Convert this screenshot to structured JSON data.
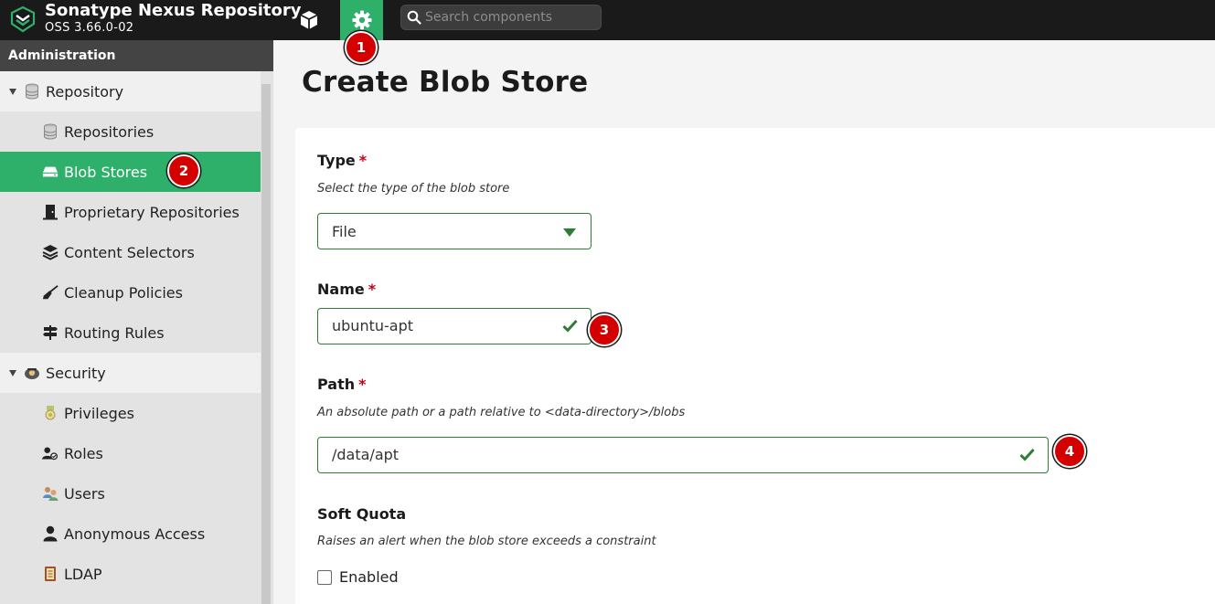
{
  "header": {
    "app_name": "Sonatype Nexus Repository",
    "version": "OSS 3.66.0-02",
    "search_placeholder": "Search components"
  },
  "badges": [
    "1",
    "2",
    "3",
    "4"
  ],
  "sidebar": {
    "header": "Administration",
    "items": [
      {
        "label": "Repository",
        "icon": "database-icon",
        "kind": "group"
      },
      {
        "label": "Repositories",
        "icon": "database-icon",
        "kind": "sub"
      },
      {
        "label": "Blob Stores",
        "icon": "hard-drive-icon",
        "kind": "sub",
        "active": true
      },
      {
        "label": "Proprietary Repositories",
        "icon": "door-icon",
        "kind": "sub"
      },
      {
        "label": "Content Selectors",
        "icon": "layers-icon",
        "kind": "sub"
      },
      {
        "label": "Cleanup Policies",
        "icon": "broom-icon",
        "kind": "sub"
      },
      {
        "label": "Routing Rules",
        "icon": "signpost-icon",
        "kind": "sub"
      },
      {
        "label": "Security",
        "icon": "security-badge-icon",
        "kind": "group"
      },
      {
        "label": "Privileges",
        "icon": "medal-icon",
        "kind": "sub"
      },
      {
        "label": "Roles",
        "icon": "user-role-icon",
        "kind": "sub"
      },
      {
        "label": "Users",
        "icon": "users-icon",
        "kind": "sub"
      },
      {
        "label": "Anonymous Access",
        "icon": "user-icon",
        "kind": "sub"
      },
      {
        "label": "LDAP",
        "icon": "book-icon",
        "kind": "sub"
      }
    ]
  },
  "main": {
    "title": "Create Blob Store",
    "type": {
      "label": "Type",
      "required": "*",
      "help": "Select the type of the blob store",
      "value": "File"
    },
    "name": {
      "label": "Name",
      "required": "*",
      "value": "ubuntu-apt"
    },
    "path": {
      "label": "Path",
      "required": "*",
      "help": "An absolute path or a path relative to <data-directory>/blobs",
      "value": "/data/apt"
    },
    "soft_quota": {
      "label": "Soft Quota",
      "help": "Raises an alert when the blob store exceeds a constraint",
      "checkbox_label": "Enabled",
      "checked": false
    }
  },
  "colors": {
    "accent": "#2eb06b",
    "valid": "#2e7d32",
    "badge": "#d40000",
    "required": "#c4001a"
  }
}
